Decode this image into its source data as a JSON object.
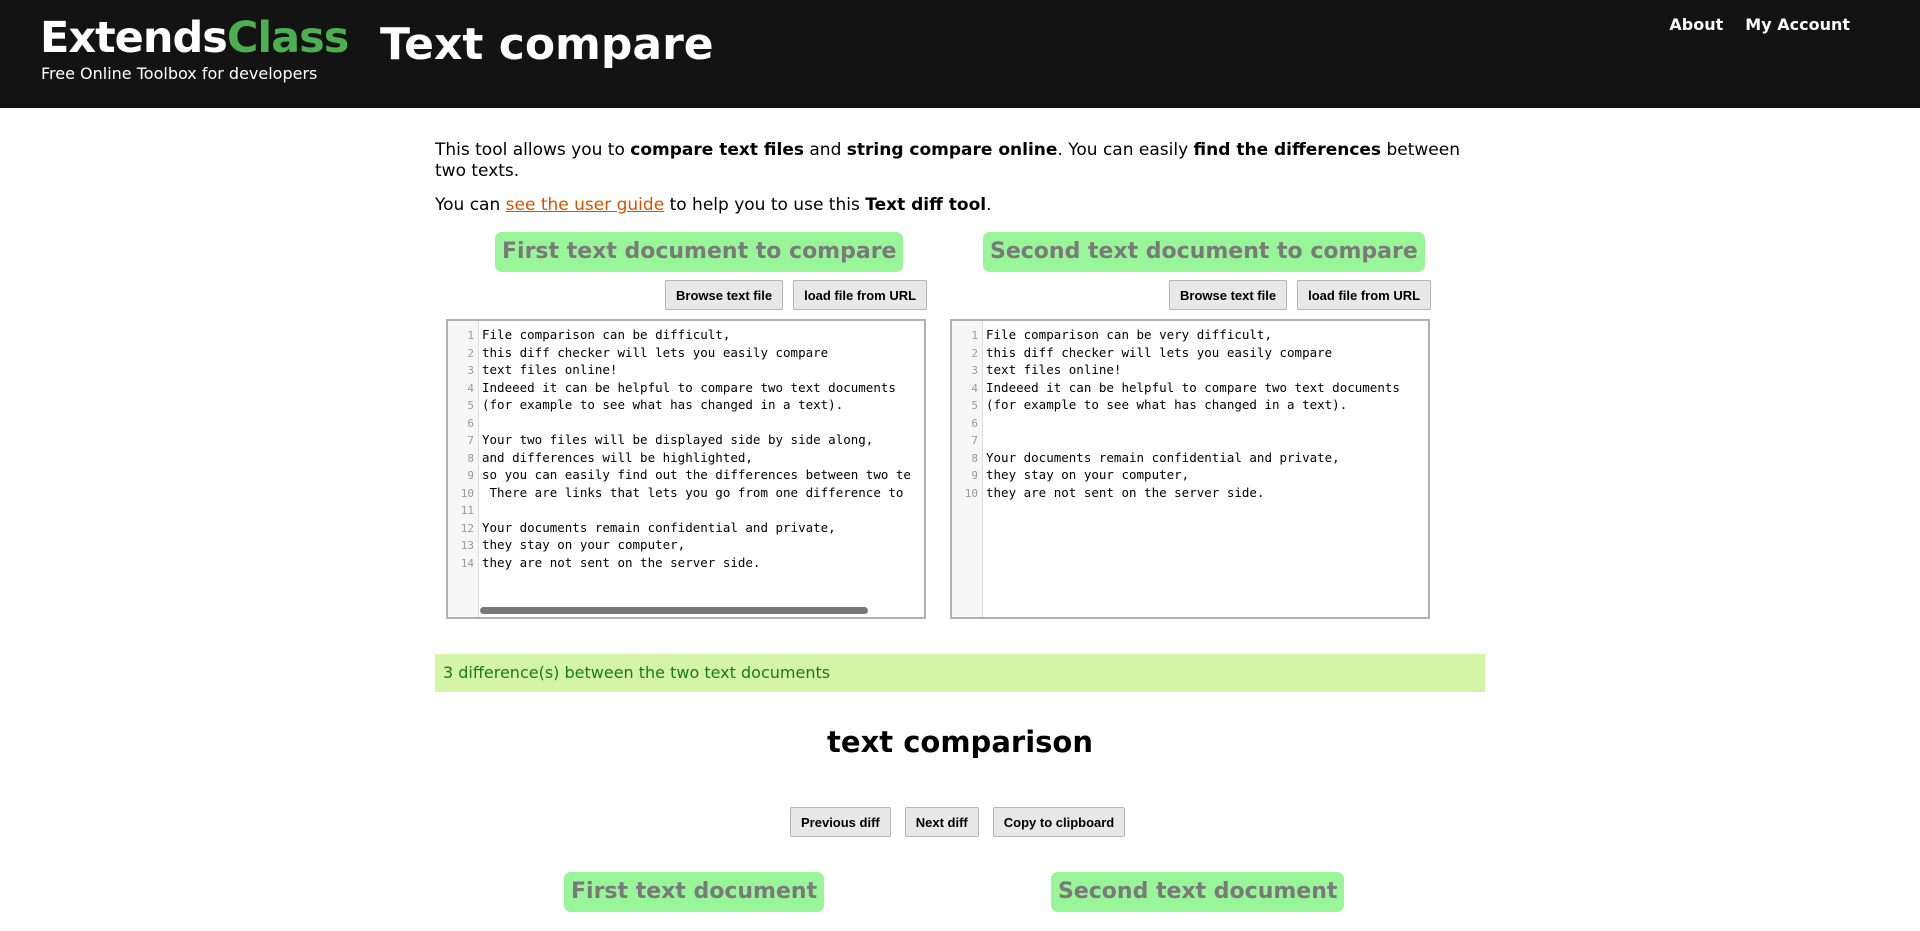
{
  "header": {
    "logo_main": "Extends",
    "logo_accent": "Class",
    "logo_sub": "Free Online Toolbox for developers",
    "title": "Text compare",
    "nav": [
      "About",
      "My Account"
    ]
  },
  "intro": {
    "p1_a": "This tool allows you to ",
    "p1_b": "compare text files",
    "p1_c": " and ",
    "p1_d": "string compare online",
    "p1_e": ". You can easily ",
    "p1_f": "find the differences",
    "p1_g": " between two texts.",
    "p2_a": "You can ",
    "p2_link": "see the user guide",
    "p2_b": " to help you to use this ",
    "p2_c": "Text diff tool",
    "p2_d": "."
  },
  "panels": {
    "left_title": "First text document to compare",
    "right_title": "Second text document to compare",
    "browse_label": "Browse text file",
    "url_label": "load file from URL"
  },
  "left_lines": [
    "File comparison can be difficult,",
    "this diff checker will lets you easily compare",
    "text files online!",
    "Indeeed it can be helpful to compare two text documents",
    "(for example to see what has changed in a text).",
    "",
    "Your two files will be displayed side by side along,",
    "and differences will be highlighted,",
    "so you can easily find out the differences between two te",
    " There are links that lets you go from one difference to ",
    "",
    "Your documents remain confidential and private,",
    "they stay on your computer,",
    "they are not sent on the server side."
  ],
  "right_lines": [
    "File comparison can be very difficult,",
    "this diff checker will lets you easily compare",
    "text files online!",
    "Indeeed it can be helpful to compare two text documents",
    "(for example to see what has changed in a text).",
    "",
    "",
    "Your documents remain confidential and private,",
    "they stay on your computer,",
    "they are not sent on the server side."
  ],
  "diff_summary": "3 difference(s) between the two text documents",
  "comparison": {
    "title": "text comparison",
    "prev_label": "Previous diff",
    "next_label": "Next diff",
    "copy_label": "Copy to clipboard",
    "left_title": "First text document",
    "right_title": "Second text document"
  },
  "colors": {
    "header_bg": "#131313",
    "accent": "#4caf50",
    "pill_bg": "#98f598",
    "link": "#d35400",
    "diff_bg": "#d4f5a8",
    "diff_text": "#1a7a1a"
  }
}
